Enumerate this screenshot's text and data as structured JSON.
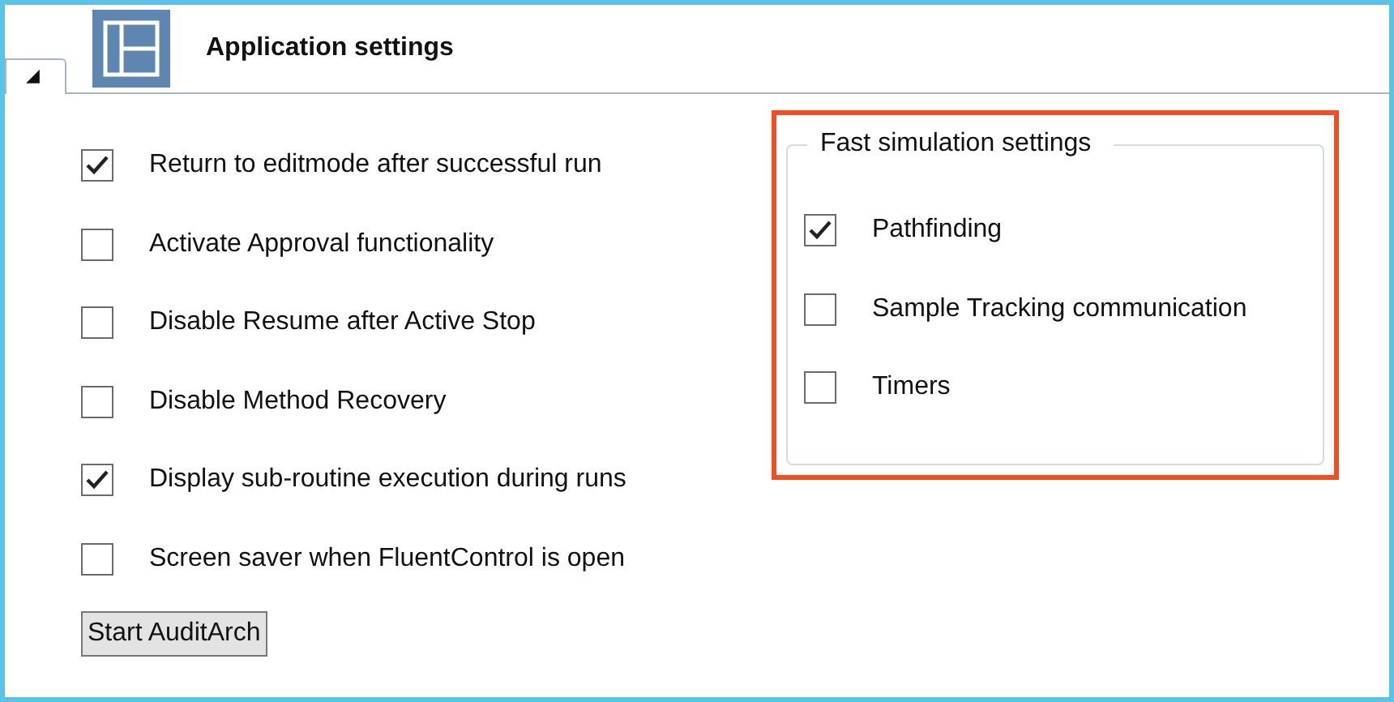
{
  "header": {
    "title": "Application settings",
    "tab_glyph": "◢"
  },
  "options": [
    {
      "label": "Return to editmode after successful run",
      "checked": true
    },
    {
      "label": "Activate Approval functionality",
      "checked": false
    },
    {
      "label": "Disable Resume after Active Stop",
      "checked": false
    },
    {
      "label": "Disable Method Recovery",
      "checked": false
    },
    {
      "label": "Display sub-routine execution during runs",
      "checked": true
    },
    {
      "label": "Screen saver when FluentControl is open",
      "checked": false
    }
  ],
  "button": "Start AuditArch",
  "fast_simulation": {
    "title": "Fast simulation settings",
    "options": [
      {
        "label": "Pathfinding",
        "checked": true
      },
      {
        "label": "Sample Tracking communication",
        "checked": false
      },
      {
        "label": "Timers",
        "checked": false
      }
    ]
  }
}
